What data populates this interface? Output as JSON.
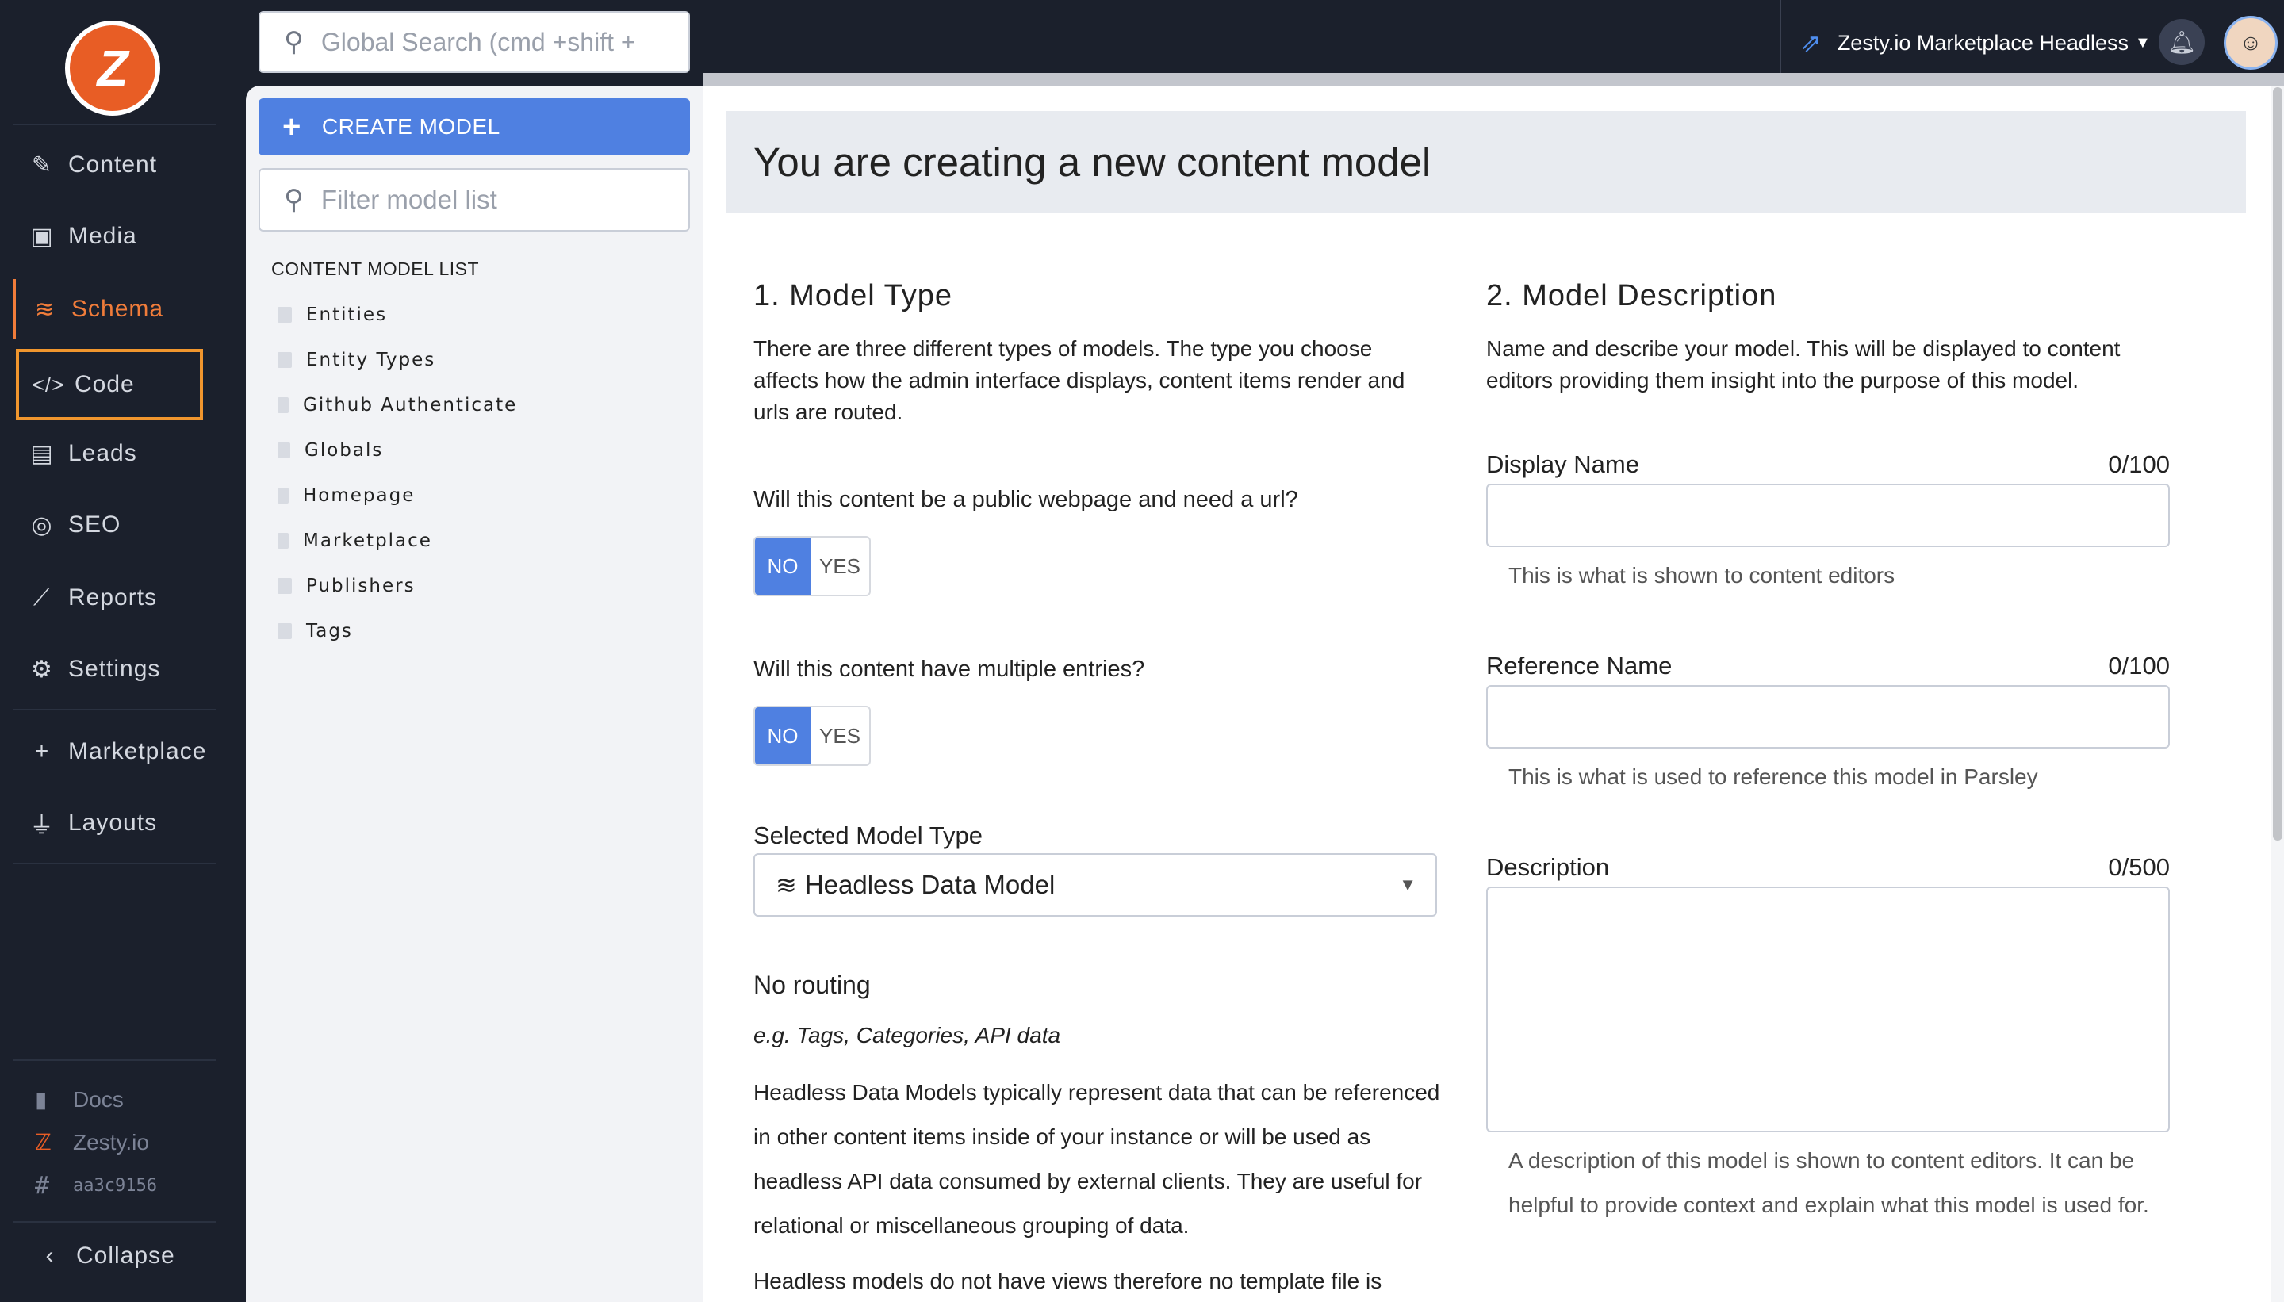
{
  "sidebar": {
    "items": [
      {
        "label": "Content",
        "icon": "edit-icon"
      },
      {
        "label": "Media",
        "icon": "image-icon"
      },
      {
        "label": "Schema",
        "icon": "database-icon"
      },
      {
        "label": "Code",
        "icon": "code-icon"
      },
      {
        "label": "Leads",
        "icon": "id-card-icon"
      },
      {
        "label": "SEO",
        "icon": "target-icon"
      },
      {
        "label": "Reports",
        "icon": "chart-line-icon"
      },
      {
        "label": "Settings",
        "icon": "gear-icon"
      },
      {
        "label": "Marketplace",
        "icon": "plus-icon"
      },
      {
        "label": "Layouts",
        "icon": "plug-icon"
      }
    ],
    "footer": {
      "docs": "Docs",
      "zesty": "Zesty.io",
      "hash": "aa3c9156",
      "collapse": "Collapse"
    },
    "accent_color": "#f07c3a",
    "focus_outline_color": "#f0962e"
  },
  "topbar": {
    "search_placeholder": "Global Search (cmd +shift +",
    "instance_name": "Zesty.io Marketplace Headless"
  },
  "model_list": {
    "create_label": "CREATE MODEL",
    "filter_placeholder": "Filter model list",
    "title": "CONTENT MODEL LIST",
    "items": [
      "Entities",
      "Entity Types",
      "Github Authenticate",
      "Globals",
      "Homepage",
      "Marketplace",
      "Publishers",
      "Tags"
    ]
  },
  "main": {
    "heading": "You are creating a new content model",
    "model_type": {
      "title": "1. Model Type",
      "description": "There are three different types of models. The type you choose affects how the admin interface displays, content items render and urls are routed.",
      "q1": "Will this content be a public webpage and need a url?",
      "q2": "Will this content have multiple entries?",
      "no": "NO",
      "yes": "YES",
      "selected_label": "Selected Model Type",
      "selected_value": "Headless Data Model",
      "routing_title": "No routing",
      "routing_example": "e.g. Tags, Categories, API data",
      "routing_desc": "Headless Data Models typically represent data that can be referenced in other content items inside of your instance or will be used as headless API data consumed by external clients. They are useful for relational or miscellaneous grouping of data.",
      "routing_desc2": "Headless models do not have views therefore no template file is"
    },
    "model_description": {
      "title": "2. Model Description",
      "description": "Name and describe your model. This will be displayed to content editors providing them insight into the purpose of this model.",
      "display_name_label": "Display Name",
      "display_name_count": "0/100",
      "display_name_hint": "This is what is shown to content editors",
      "reference_name_label": "Reference Name",
      "reference_name_count": "0/100",
      "reference_name_hint": "This is what is used to reference this model in Parsley",
      "description_label": "Description",
      "description_count": "0/500",
      "description_hint": "A description of this model is shown to content editors. It can be helpful to provide context and explain what this model is used for."
    }
  }
}
